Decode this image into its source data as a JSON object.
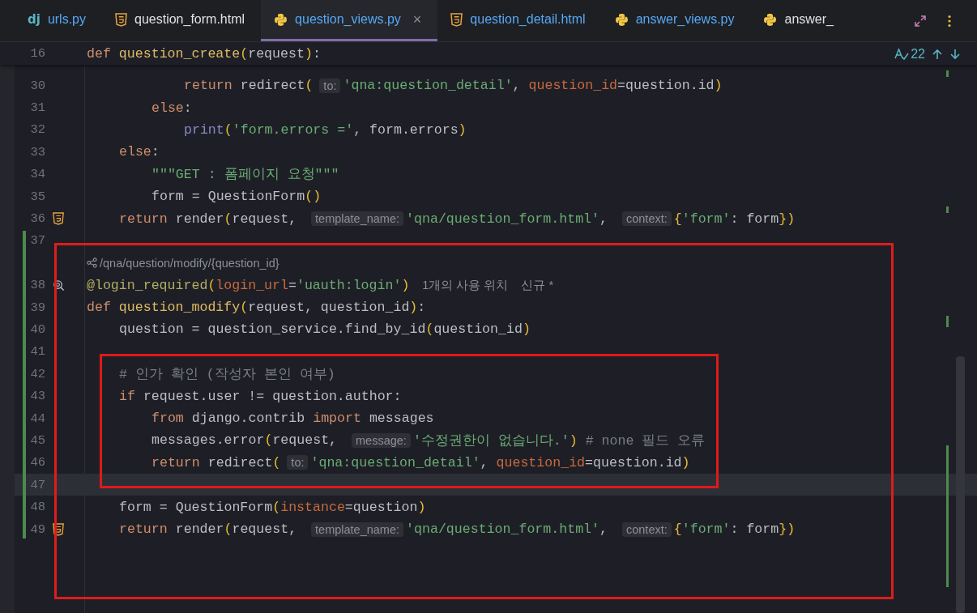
{
  "tabs": [
    {
      "label": "urls.py",
      "kind": "django",
      "icon_text": "dj",
      "modified": true,
      "selected": false
    },
    {
      "label": "question_form.html",
      "kind": "html",
      "modified": false,
      "selected": false
    },
    {
      "label": "question_views.py",
      "kind": "python",
      "modified": true,
      "selected": true,
      "close": "×"
    },
    {
      "label": "question_detail.html",
      "kind": "html",
      "modified": true,
      "selected": false
    },
    {
      "label": "answer_views.py",
      "kind": "python",
      "modified": true,
      "selected": false
    },
    {
      "label": "answer_",
      "kind": "python",
      "modified": false,
      "selected": false
    }
  ],
  "inspections": {
    "count": "22"
  },
  "sticky_line": {
    "number": "16",
    "tokens": [
      {
        "kind": "kw",
        "t": "def "
      },
      {
        "kind": "fn",
        "t": "question_create"
      },
      {
        "kind": "paren",
        "t": "("
      },
      {
        "kind": "plain",
        "t": "request"
      },
      {
        "kind": "paren",
        "t": ")"
      },
      {
        "kind": "plain",
        "t": ":"
      }
    ]
  },
  "lines": [
    {
      "kind": "code",
      "number": "30",
      "current": false,
      "tokens": [
        {
          "kind": "kw",
          "t": "            return "
        },
        {
          "kind": "plain",
          "t": "redirect"
        },
        {
          "kind": "paren",
          "t": "("
        },
        {
          "kind": "hint",
          "t": "to:"
        },
        {
          "kind": "str",
          "t": "'qna:question_detail'"
        },
        {
          "kind": "plain",
          "t": ", "
        },
        {
          "kind": "param",
          "t": "question_id"
        },
        {
          "kind": "plain",
          "t": "=question.id"
        },
        {
          "kind": "paren",
          "t": ")"
        }
      ]
    },
    {
      "kind": "code",
      "number": "31",
      "current": false,
      "tokens": [
        {
          "kind": "kw",
          "t": "        else"
        },
        {
          "kind": "plain",
          "t": ":"
        }
      ]
    },
    {
      "kind": "code",
      "number": "32",
      "current": false,
      "tokens": [
        {
          "kind": "builtin",
          "t": "            print"
        },
        {
          "kind": "paren",
          "t": "("
        },
        {
          "kind": "str",
          "t": "'form.errors ='"
        },
        {
          "kind": "plain",
          "t": ", form.errors"
        },
        {
          "kind": "paren",
          "t": ")"
        }
      ]
    },
    {
      "kind": "code",
      "number": "33",
      "current": false,
      "tokens": [
        {
          "kind": "kw",
          "t": "    else"
        },
        {
          "kind": "plain",
          "t": ":"
        }
      ]
    },
    {
      "kind": "code",
      "number": "34",
      "current": false,
      "tokens": [
        {
          "kind": "str",
          "t": "        \"\"\"GET : 폼페이지 요청\"\"\""
        }
      ]
    },
    {
      "kind": "code",
      "number": "35",
      "current": false,
      "tokens": [
        {
          "kind": "plain",
          "t": "        form = QuestionForm"
        },
        {
          "kind": "paren",
          "t": "()"
        }
      ]
    },
    {
      "kind": "code",
      "number": "36",
      "current": false,
      "gutter": {
        "kind": "html"
      },
      "tokens": [
        {
          "kind": "kw",
          "t": "    return "
        },
        {
          "kind": "plain",
          "t": "render"
        },
        {
          "kind": "paren",
          "t": "("
        },
        {
          "kind": "plain",
          "t": "request, "
        },
        {
          "kind": "hint",
          "t": "template_name:"
        },
        {
          "kind": "str",
          "t": "'qna/question_form.html'"
        },
        {
          "kind": "plain",
          "t": ", "
        },
        {
          "kind": "hint",
          "t": "context:"
        },
        {
          "kind": "paren",
          "t": "{"
        },
        {
          "kind": "str",
          "t": "'form'"
        },
        {
          "kind": "plain",
          "t": ": form"
        },
        {
          "kind": "paren",
          "t": "})"
        }
      ]
    },
    {
      "kind": "code",
      "number": "37",
      "current": false
    },
    {
      "kind": "route",
      "text": "/qna/question/modify/{question_id}"
    },
    {
      "kind": "code",
      "number": "38",
      "current": false,
      "gutter": {
        "kind": "usages"
      },
      "tokens": [
        {
          "kind": "deco",
          "t": "@login_required"
        },
        {
          "kind": "paren",
          "t": "("
        },
        {
          "kind": "param",
          "t": "login_url"
        },
        {
          "kind": "plain",
          "t": "="
        },
        {
          "kind": "str",
          "t": "'uauth:login'"
        },
        {
          "kind": "paren",
          "t": ")"
        },
        {
          "kind": "note",
          "t": "1개의 사용 위치"
        },
        {
          "kind": "note",
          "t": "신규 *"
        }
      ]
    },
    {
      "kind": "code",
      "number": "39",
      "current": false,
      "tokens": [
        {
          "kind": "kw",
          "t": "def "
        },
        {
          "kind": "fn",
          "t": "question_modify"
        },
        {
          "kind": "paren",
          "t": "("
        },
        {
          "kind": "plain",
          "t": "request, question_id"
        },
        {
          "kind": "paren",
          "t": ")"
        },
        {
          "kind": "plain",
          "t": ":"
        }
      ]
    },
    {
      "kind": "code",
      "number": "40",
      "current": false,
      "tokens": [
        {
          "kind": "plain",
          "t": "    question = question_service.find_by_id"
        },
        {
          "kind": "paren",
          "t": "("
        },
        {
          "kind": "plain",
          "t": "question_id"
        },
        {
          "kind": "paren",
          "t": ")"
        }
      ]
    },
    {
      "kind": "code",
      "number": "41",
      "current": false
    },
    {
      "kind": "code",
      "number": "42",
      "current": false,
      "tokens": [
        {
          "kind": "comment",
          "t": "    # 인가 확인 (작성자 본인 여부)"
        }
      ]
    },
    {
      "kind": "code",
      "number": "43",
      "current": false,
      "tokens": [
        {
          "kind": "kw",
          "t": "    if "
        },
        {
          "kind": "plain",
          "t": "request.user != question.author:"
        }
      ]
    },
    {
      "kind": "code",
      "number": "44",
      "current": false,
      "tokens": [
        {
          "kind": "kw",
          "t": "        from "
        },
        {
          "kind": "plain",
          "t": "django.contrib "
        },
        {
          "kind": "kw",
          "t": "import "
        },
        {
          "kind": "plain",
          "t": "messages"
        }
      ]
    },
    {
      "kind": "code",
      "number": "45",
      "current": false,
      "tokens": [
        {
          "kind": "plain",
          "t": "        messages.error"
        },
        {
          "kind": "paren",
          "t": "("
        },
        {
          "kind": "plain",
          "t": "request, "
        },
        {
          "kind": "hint",
          "t": "message:"
        },
        {
          "kind": "str",
          "t": "'수정권한이 없습니다.'"
        },
        {
          "kind": "paren",
          "t": ")"
        },
        {
          "kind": "comment",
          "t": " # none 필드 오류"
        }
      ]
    },
    {
      "kind": "code",
      "number": "46",
      "current": false,
      "tokens": [
        {
          "kind": "kw",
          "t": "        return "
        },
        {
          "kind": "plain",
          "t": "redirect"
        },
        {
          "kind": "paren",
          "t": "("
        },
        {
          "kind": "hint",
          "t": "to:"
        },
        {
          "kind": "str",
          "t": "'qna:question_detail'"
        },
        {
          "kind": "plain",
          "t": ", "
        },
        {
          "kind": "param",
          "t": "question_id"
        },
        {
          "kind": "plain",
          "t": "=question.id"
        },
        {
          "kind": "paren",
          "t": ")"
        }
      ]
    },
    {
      "kind": "code",
      "number": "47",
      "current": true
    },
    {
      "kind": "code",
      "number": "48",
      "current": false,
      "tokens": [
        {
          "kind": "plain",
          "t": "    form = QuestionForm"
        },
        {
          "kind": "paren",
          "t": "("
        },
        {
          "kind": "param",
          "t": "instance"
        },
        {
          "kind": "plain",
          "t": "=question"
        },
        {
          "kind": "paren",
          "t": ")"
        }
      ]
    },
    {
      "kind": "code",
      "number": "49",
      "current": false,
      "gutter": {
        "kind": "html"
      },
      "tokens": [
        {
          "kind": "kw",
          "t": "    return "
        },
        {
          "kind": "plain",
          "t": "render"
        },
        {
          "kind": "paren",
          "t": "("
        },
        {
          "kind": "plain",
          "t": "request, "
        },
        {
          "kind": "hint",
          "t": "template_name:"
        },
        {
          "kind": "str",
          "t": "'qna/question_form.html'"
        },
        {
          "kind": "plain",
          "t": ", "
        },
        {
          "kind": "hint",
          "t": "context:"
        },
        {
          "kind": "paren",
          "t": "{"
        },
        {
          "kind": "str",
          "t": "'form'"
        },
        {
          "kind": "plain",
          "t": ": form"
        },
        {
          "kind": "paren",
          "t": "})"
        }
      ]
    }
  ],
  "highlight_boxes": [
    {
      "color": "#e01b1b"
    },
    {
      "color": "#dd1a1a"
    }
  ]
}
